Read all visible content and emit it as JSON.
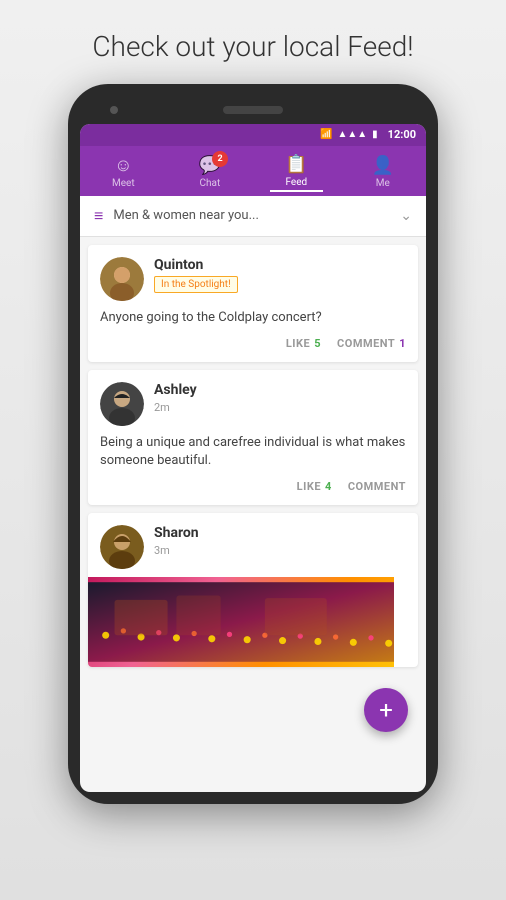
{
  "page": {
    "title": "Check out your local Feed!"
  },
  "status_bar": {
    "time": "12:00",
    "wifi": "📶",
    "signal": "📶",
    "battery": "🔋"
  },
  "nav": {
    "tabs": [
      {
        "id": "meet",
        "label": "Meet",
        "icon": "☺",
        "active": false,
        "badge": null
      },
      {
        "id": "chat",
        "label": "Chat",
        "icon": "💬",
        "active": false,
        "badge": "2"
      },
      {
        "id": "feed",
        "label": "Feed",
        "icon": "📋",
        "active": true,
        "badge": null
      },
      {
        "id": "me",
        "label": "Me",
        "icon": "👤",
        "active": false,
        "badge": null
      }
    ]
  },
  "filter": {
    "text": "Men & women near you...",
    "icon": "≡"
  },
  "posts": [
    {
      "id": 1,
      "username": "Quinton",
      "spotlight": "In the Spotlight!",
      "time": null,
      "text": "Anyone going to the Coldplay concert?",
      "likes": 5,
      "comments": 1,
      "has_image": false
    },
    {
      "id": 2,
      "username": "Ashley",
      "spotlight": null,
      "time": "2m",
      "text": "Being a unique and carefree individual is what makes someone beautiful.",
      "likes": 4,
      "comments": null,
      "has_image": false
    },
    {
      "id": 3,
      "username": "Sharon",
      "spotlight": null,
      "time": "3m",
      "text": "",
      "likes": null,
      "comments": null,
      "has_image": true
    }
  ],
  "actions": {
    "like_label": "LIKE",
    "comment_label": "COMMENT"
  },
  "fab": {
    "icon": "+",
    "label": "Create post"
  }
}
